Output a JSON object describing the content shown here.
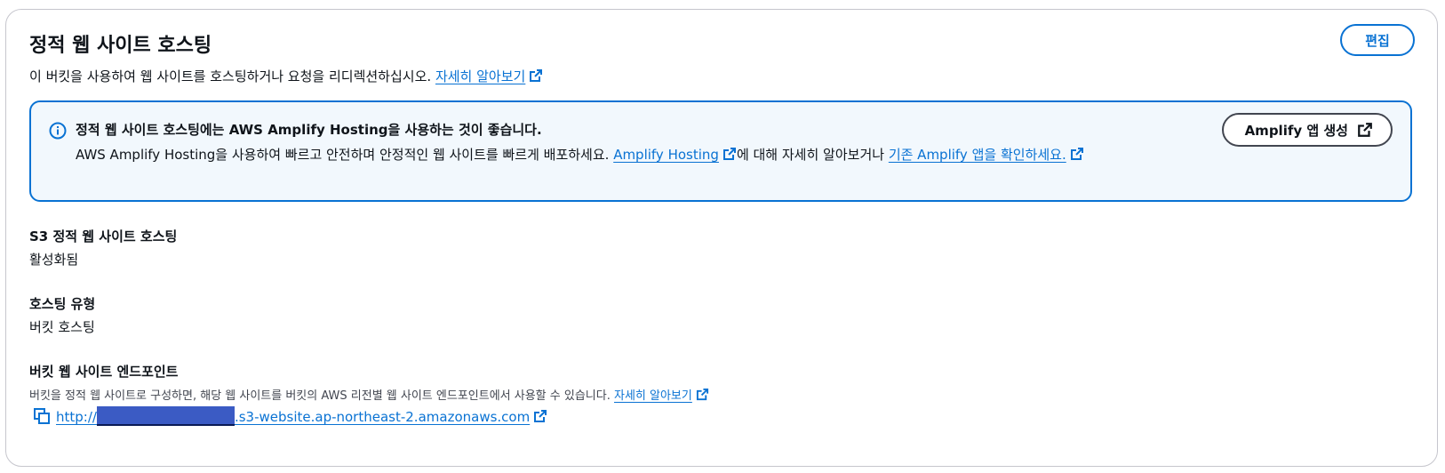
{
  "header": {
    "title": "정적 웹 사이트 호스팅",
    "description": "이 버킷을 사용하여 웹 사이트를 호스팅하거나 요청을 리디렉션하십시오.",
    "learn_more": "자세히 알아보기",
    "edit_label": "편집"
  },
  "alert": {
    "title": "정적 웹 사이트 호스팅에는 AWS Amplify Hosting을 사용하는 것이 좋습니다.",
    "body_prefix": "AWS Amplify Hosting을 사용하여 빠르고 안전하며 안정적인 웹 사이트를 빠르게 배포하세요. ",
    "link1": "Amplify Hosting",
    "body_mid": "에 대해 자세히 알아보거나 ",
    "link2": "기존 Amplify 앱을 확인하세요.",
    "button_label": "Amplify 앱 생성"
  },
  "fields": {
    "s3_hosting": {
      "label": "S3 정적 웹 사이트 호스팅",
      "value": "활성화됨"
    },
    "hosting_type": {
      "label": "호스팅 유형",
      "value": "버킷 호스팅"
    },
    "endpoint": {
      "label": "버킷 웹 사이트 엔드포인트",
      "description": "버킷을 정적 웹 사이트로 구성하면, 해당 웹 사이트를 버킷의 AWS 리전별 웹 사이트 엔드포인트에서 사용할 수 있습니다.",
      "learn_more": "자세히 알아보기",
      "url_prefix": "http://",
      "url_suffix": ".s3-website.ap-northeast-2.amazonaws.com"
    }
  },
  "colors": {
    "link": "#0972d3",
    "alert_bg": "#f2f8fd",
    "redaction": "#3b5bc4"
  }
}
